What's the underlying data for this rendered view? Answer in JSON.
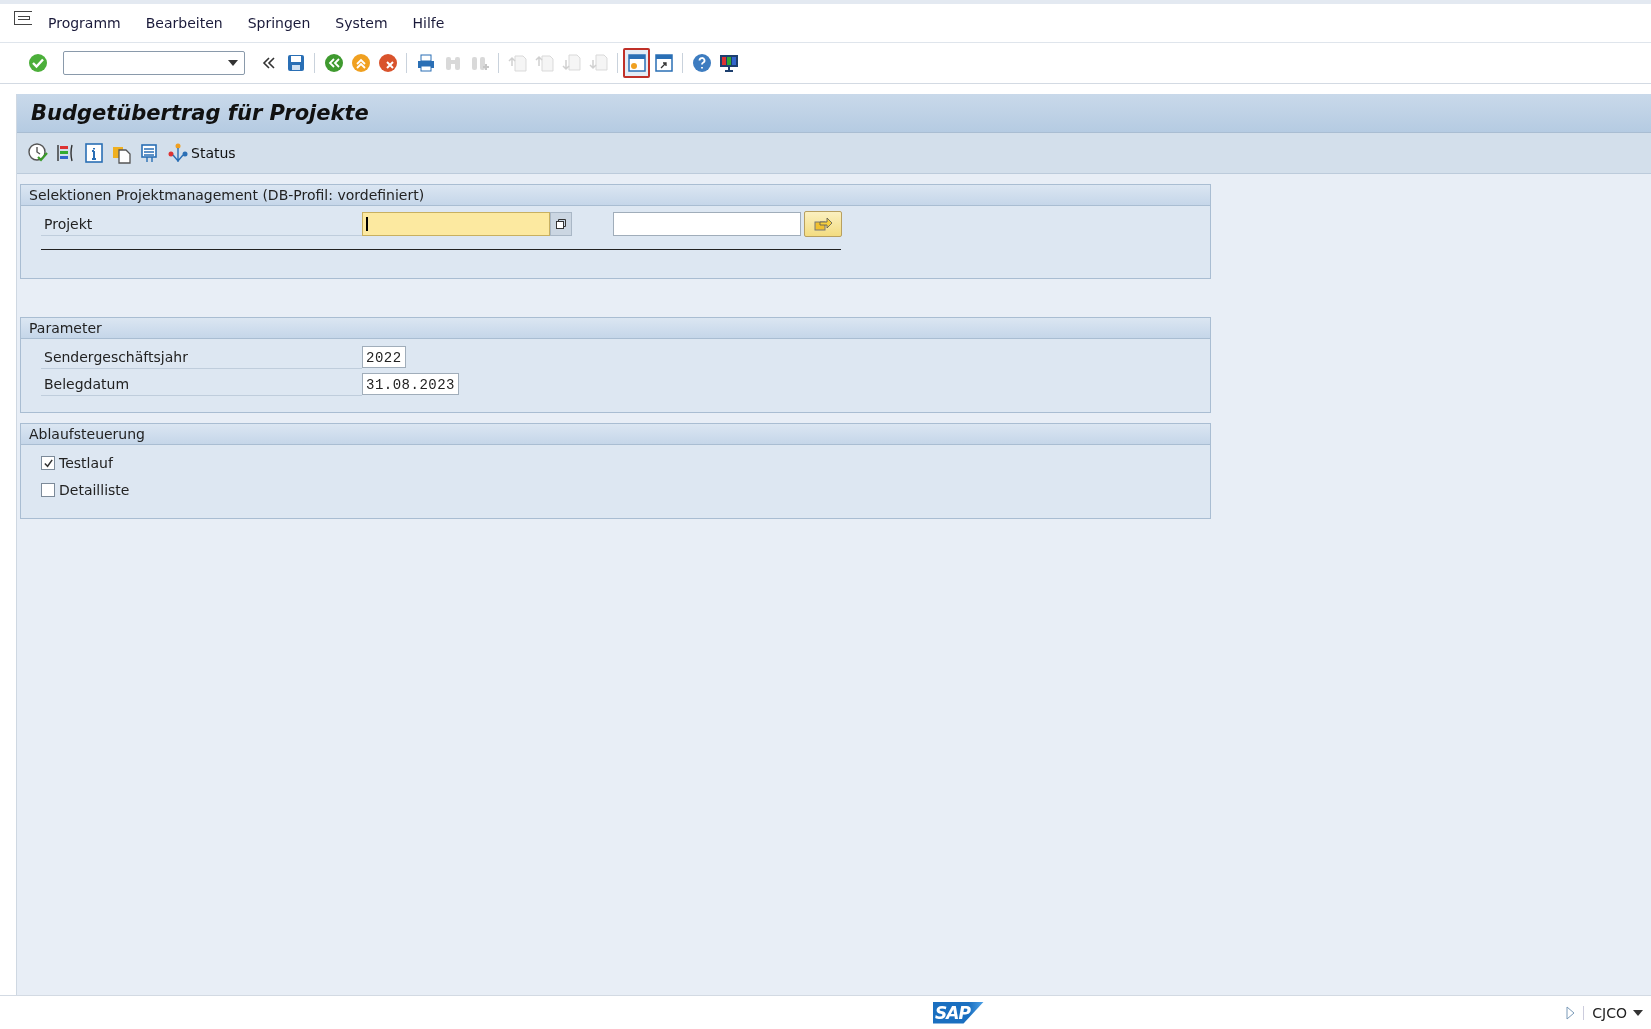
{
  "menu_bar": {
    "items": [
      "Programm",
      "Bearbeiten",
      "Springen",
      "System",
      "Hilfe"
    ]
  },
  "toolbar": {
    "buttons": [
      {
        "kind": "enter",
        "disabled": false,
        "focused": false
      },
      {
        "kind": "command-field"
      },
      {
        "kind": "collapse",
        "disabled": false,
        "focused": false
      },
      {
        "kind": "save",
        "disabled": false,
        "focused": false
      },
      {
        "kind": "separator"
      },
      {
        "kind": "back",
        "disabled": false,
        "focused": false
      },
      {
        "kind": "exit",
        "disabled": false,
        "focused": false
      },
      {
        "kind": "cancel",
        "disabled": false,
        "focused": false
      },
      {
        "kind": "separator"
      },
      {
        "kind": "print",
        "disabled": false,
        "focused": false
      },
      {
        "kind": "find",
        "disabled": true,
        "focused": false
      },
      {
        "kind": "find-next",
        "disabled": true,
        "focused": false
      },
      {
        "kind": "separator"
      },
      {
        "kind": "first-page",
        "disabled": true,
        "focused": false
      },
      {
        "kind": "previous-page",
        "disabled": true,
        "focused": false
      },
      {
        "kind": "next-page",
        "disabled": true,
        "focused": false
      },
      {
        "kind": "last-page",
        "disabled": true,
        "focused": false
      },
      {
        "kind": "separator"
      },
      {
        "kind": "new-session",
        "disabled": false,
        "focused": true
      },
      {
        "kind": "shortcut",
        "disabled": false,
        "focused": false
      },
      {
        "kind": "separator"
      },
      {
        "kind": "help",
        "disabled": false,
        "focused": false
      },
      {
        "kind": "layout",
        "disabled": false,
        "focused": false
      }
    ]
  },
  "title": "Budgetübertrag für Projekte",
  "app_toolbar": {
    "buttons": [
      {
        "kind": "execute"
      },
      {
        "kind": "variants"
      },
      {
        "kind": "info"
      },
      {
        "kind": "copy"
      },
      {
        "kind": "selection-screen"
      },
      {
        "kind": "status",
        "label": "Status"
      }
    ]
  },
  "sections": [
    {
      "title": "Selektionen Projektmanagement (DB-Profil: vordefiniert)",
      "rule": true,
      "rows": [
        {
          "kind": "range",
          "label": "Projekt",
          "focused": true
        }
      ]
    },
    {
      "title": "Parameter",
      "rule": false,
      "rows": [
        {
          "kind": "field",
          "label": "Sendergeschäftsjahr",
          "value": "2022"
        },
        {
          "kind": "field",
          "label": "Belegdatum",
          "value": "31.08.2023"
        }
      ]
    },
    {
      "title": "Ablaufsteuerung",
      "rule": false,
      "rows": [
        {
          "kind": "checkbox",
          "label": "Testlauf",
          "checked": true
        },
        {
          "kind": "checkbox",
          "label": "Detailliste",
          "checked": false
        }
      ]
    }
  ],
  "status_bar": {
    "logo": "SAP",
    "transaction": "CJCO"
  }
}
